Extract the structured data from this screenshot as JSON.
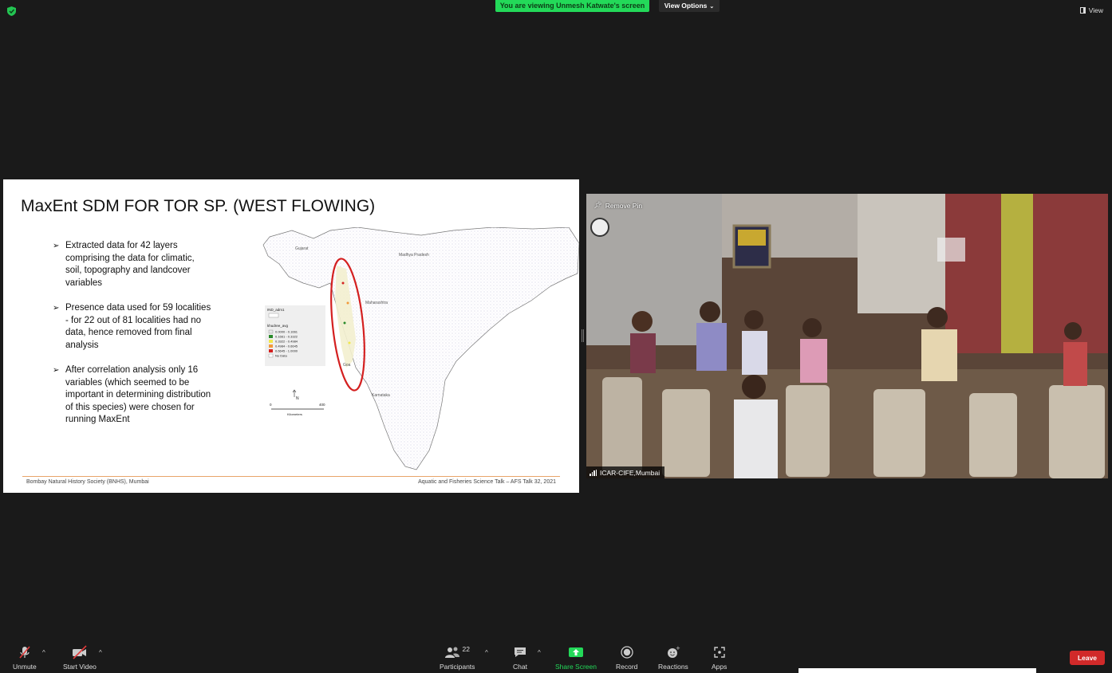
{
  "top_bar": {
    "viewing_banner": "You are viewing Unmesh Katwate's screen",
    "view_options": "View Options",
    "view_label": "View"
  },
  "slide": {
    "title": "MaxEnt SDM FOR TOR SP. (WEST FLOWING)",
    "bullets": [
      "Extracted data for 42 layers comprising the data for climatic, soil, topography and landcover variables",
      "Presence data used for 59 localities - for 22 out of 81 localities had no data, hence removed from final analysis",
      "After correlation analysis only 16 variables (which seemed to be important in determining distribution of this species)  were chosen for running MaxEnt"
    ],
    "map": {
      "labels": {
        "gujarat": "Gujarat",
        "madhya_pradesh": "Madhya Pradesh",
        "maharashtra": "Maharashtra",
        "goa": "Goa",
        "karnataka": "Karnataka"
      },
      "legend": {
        "layer1": "IND_adm1",
        "layer2": "khudree_avg",
        "items": [
          "0.0000 - 0.1661",
          "0.1661 - 0.3322",
          "0.3322 - 0.4984",
          "0.4984 - 0.6645",
          "0.6645 - 1.0000",
          "No Data"
        ],
        "colors": [
          "#e8e8e8",
          "#2a8a2a",
          "#f2e84a",
          "#f29a3a",
          "#d42020",
          "#ffffff"
        ]
      },
      "scale": {
        "start": "0",
        "end": "400",
        "unit": "Kilometers",
        "north": "N"
      }
    },
    "footer_left": "Bombay Natural History Society (BNHS), Mumbai",
    "footer_right": "Aquatic and Fisheries Science Talk – AFS Talk 32, 2021"
  },
  "video": {
    "remove_pin": "Remove Pin",
    "name": "ICAR-CIFE,Mumbai"
  },
  "toolbar": {
    "unmute": "Unmute",
    "start_video": "Start Video",
    "participants": "Participants",
    "participants_count": "22",
    "chat": "Chat",
    "share_screen": "Share Screen",
    "record": "Record",
    "reactions": "Reactions",
    "apps": "Apps",
    "leave": "Leave"
  },
  "colors": {
    "background": "#1a1a1a",
    "banner_green": "#23d959",
    "share_green": "#23d959",
    "leave_red": "#d12a2a",
    "slide_footer_line": "#e9a56a",
    "highlight_ellipse": "#d42020"
  }
}
